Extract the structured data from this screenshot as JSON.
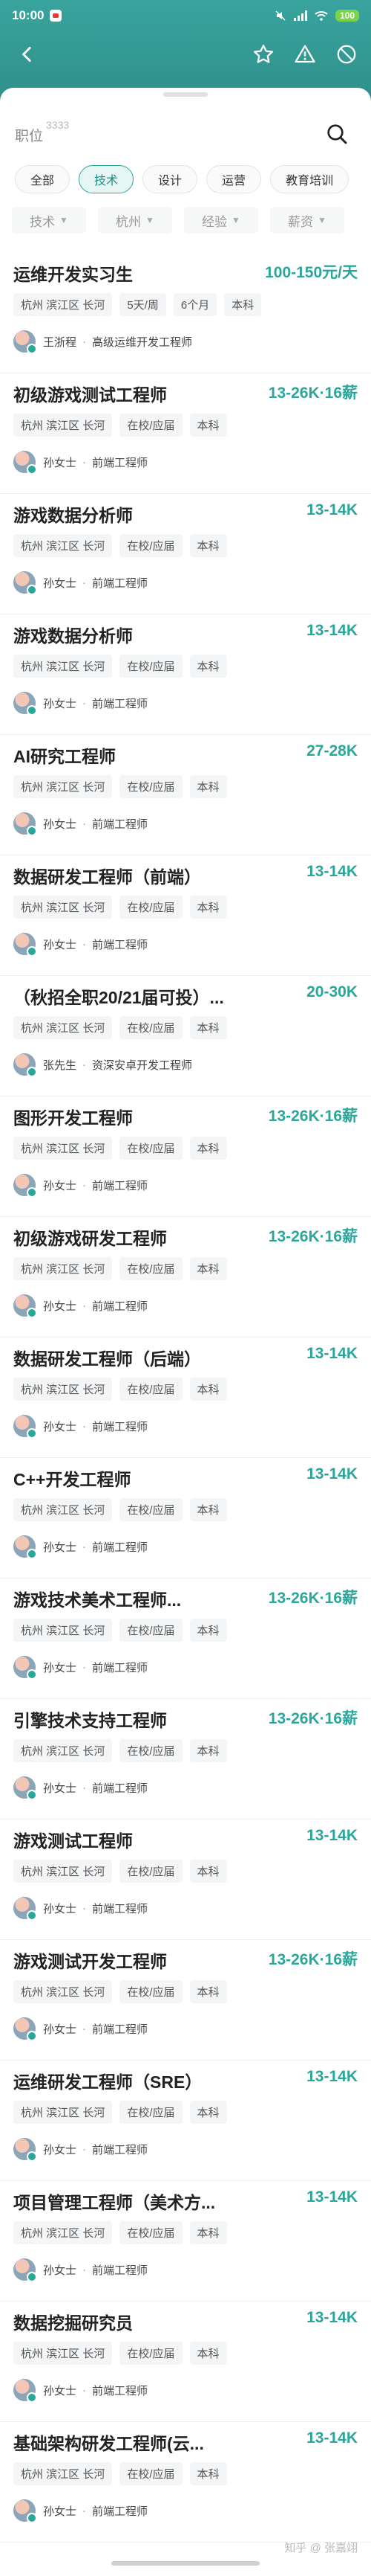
{
  "status": {
    "time": "10:00",
    "battery": "100"
  },
  "search": {
    "label": "职位",
    "count": "3333"
  },
  "tabs": [
    {
      "label": "全部",
      "active": false
    },
    {
      "label": "技术",
      "active": true
    },
    {
      "label": "设计",
      "active": false
    },
    {
      "label": "运营",
      "active": false
    },
    {
      "label": "教育培训",
      "active": false
    }
  ],
  "filters": [
    {
      "label": "技术"
    },
    {
      "label": "杭州"
    },
    {
      "label": "经验"
    },
    {
      "label": "薪资"
    }
  ],
  "jobs": [
    {
      "title": "运维开发实习生",
      "salary": "100-150元/天",
      "tags": [
        "杭州 滨江区 长河",
        "5天/周",
        "6个月",
        "本科"
      ],
      "recruiter": "王浙程",
      "role": "高级运维开发工程师"
    },
    {
      "title": "初级游戏测试工程师",
      "salary": "13-26K·16薪",
      "tags": [
        "杭州 滨江区 长河",
        "在校/应届",
        "本科"
      ],
      "recruiter": "孙女士",
      "role": "前端工程师"
    },
    {
      "title": "游戏数据分析师",
      "salary": "13-14K",
      "tags": [
        "杭州 滨江区 长河",
        "在校/应届",
        "本科"
      ],
      "recruiter": "孙女士",
      "role": "前端工程师"
    },
    {
      "title": "游戏数据分析师",
      "salary": "13-14K",
      "tags": [
        "杭州 滨江区 长河",
        "在校/应届",
        "本科"
      ],
      "recruiter": "孙女士",
      "role": "前端工程师"
    },
    {
      "title": "AI研究工程师",
      "salary": "27-28K",
      "tags": [
        "杭州 滨江区 长河",
        "在校/应届",
        "本科"
      ],
      "recruiter": "孙女士",
      "role": "前端工程师"
    },
    {
      "title": "数据研发工程师（前端）",
      "salary": "13-14K",
      "tags": [
        "杭州 滨江区 长河",
        "在校/应届",
        "本科"
      ],
      "recruiter": "孙女士",
      "role": "前端工程师"
    },
    {
      "title": "（秋招全职20/21届可投）...",
      "salary": "20-30K",
      "tags": [
        "杭州 滨江区 长河",
        "在校/应届",
        "本科"
      ],
      "recruiter": "张先生",
      "role": "资深安卓开发工程师"
    },
    {
      "title": "图形开发工程师",
      "salary": "13-26K·16薪",
      "tags": [
        "杭州 滨江区 长河",
        "在校/应届",
        "本科"
      ],
      "recruiter": "孙女士",
      "role": "前端工程师"
    },
    {
      "title": "初级游戏研发工程师",
      "salary": "13-26K·16薪",
      "tags": [
        "杭州 滨江区 长河",
        "在校/应届",
        "本科"
      ],
      "recruiter": "孙女士",
      "role": "前端工程师"
    },
    {
      "title": "数据研发工程师（后端）",
      "salary": "13-14K",
      "tags": [
        "杭州 滨江区 长河",
        "在校/应届",
        "本科"
      ],
      "recruiter": "孙女士",
      "role": "前端工程师"
    },
    {
      "title": "C++开发工程师",
      "salary": "13-14K",
      "tags": [
        "杭州 滨江区 长河",
        "在校/应届",
        "本科"
      ],
      "recruiter": "孙女士",
      "role": "前端工程师"
    },
    {
      "title": "游戏技术美术工程师...",
      "salary": "13-26K·16薪",
      "tags": [
        "杭州 滨江区 长河",
        "在校/应届",
        "本科"
      ],
      "recruiter": "孙女士",
      "role": "前端工程师"
    },
    {
      "title": "引擎技术支持工程师",
      "salary": "13-26K·16薪",
      "tags": [
        "杭州 滨江区 长河",
        "在校/应届",
        "本科"
      ],
      "recruiter": "孙女士",
      "role": "前端工程师"
    },
    {
      "title": "游戏测试工程师",
      "salary": "13-14K",
      "tags": [
        "杭州 滨江区 长河",
        "在校/应届",
        "本科"
      ],
      "recruiter": "孙女士",
      "role": "前端工程师"
    },
    {
      "title": "游戏测试开发工程师",
      "salary": "13-26K·16薪",
      "tags": [
        "杭州 滨江区 长河",
        "在校/应届",
        "本科"
      ],
      "recruiter": "孙女士",
      "role": "前端工程师"
    },
    {
      "title": "运维研发工程师（SRE）",
      "salary": "13-14K",
      "tags": [
        "杭州 滨江区 长河",
        "在校/应届",
        "本科"
      ],
      "recruiter": "孙女士",
      "role": "前端工程师"
    },
    {
      "title": "项目管理工程师（美术方...",
      "salary": "13-14K",
      "tags": [
        "杭州 滨江区 长河",
        "在校/应届",
        "本科"
      ],
      "recruiter": "孙女士",
      "role": "前端工程师"
    },
    {
      "title": "数据挖掘研究员",
      "salary": "13-14K",
      "tags": [
        "杭州 滨江区 长河",
        "在校/应届",
        "本科"
      ],
      "recruiter": "孙女士",
      "role": "前端工程师"
    },
    {
      "title": "基础架构研发工程师(云...",
      "salary": "13-14K",
      "tags": [
        "杭州 滨江区 长河",
        "在校/应届",
        "本科"
      ],
      "recruiter": "孙女士",
      "role": "前端工程师"
    }
  ],
  "watermark": "知乎 @ 张嘉翊",
  "colors": {
    "accent": "#2aa69a",
    "header": "#3aa49e"
  }
}
